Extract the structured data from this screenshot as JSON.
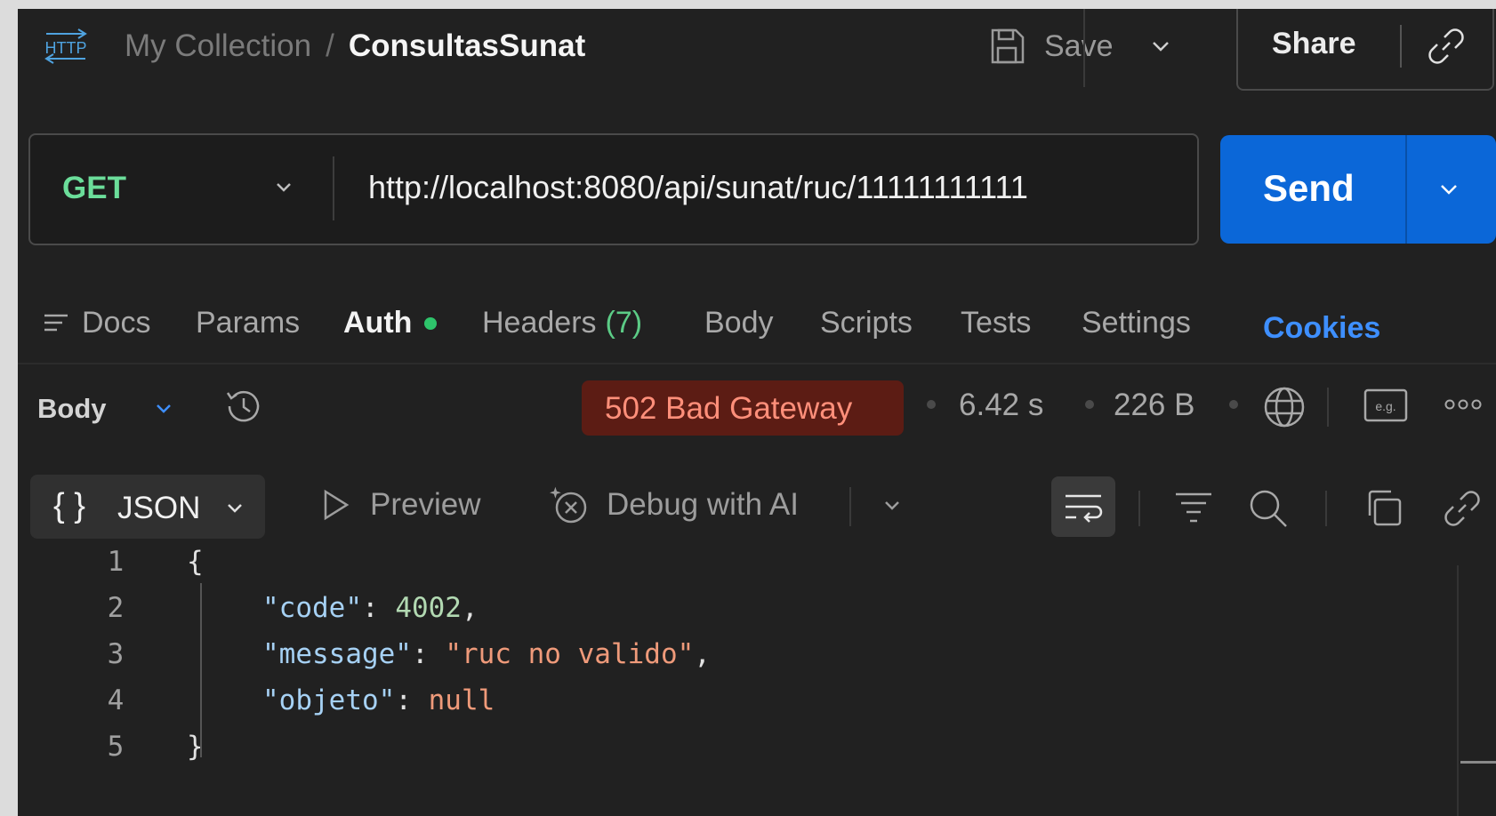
{
  "header": {
    "http_icon_label": "HTTP",
    "breadcrumb_parent": "My Collection",
    "breadcrumb_separator": "/",
    "breadcrumb_current": "ConsultasSunat",
    "save_label": "Save",
    "share_label": "Share"
  },
  "request": {
    "method": "GET",
    "url": "http://localhost:8080/api/sunat/ruc/11111111111",
    "send_label": "Send"
  },
  "request_tabs": {
    "docs": "Docs",
    "params": "Params",
    "auth": "Auth",
    "headers": "Headers",
    "headers_count": "(7)",
    "body": "Body",
    "scripts": "Scripts",
    "tests": "Tests",
    "settings": "Settings",
    "cookies": "Cookies"
  },
  "response": {
    "body_label": "Body",
    "status": "502 Bad Gateway",
    "time": "6.42 s",
    "size": "226 B",
    "eg_label": "e.g."
  },
  "viewer": {
    "format_braces": "{ }",
    "format_label": "JSON",
    "preview_label": "Preview",
    "debug_label": "Debug with AI"
  },
  "code": {
    "line_numbers": [
      "1",
      "2",
      "3",
      "4",
      "5"
    ],
    "open_brace": "{",
    "close_brace": "}",
    "code_key": "\"code\"",
    "code_value": "4002",
    "message_key": "\"message\"",
    "message_value": "\"ruc no valido\"",
    "objeto_key": "\"objeto\"",
    "objeto_value": "null",
    "colon": ": ",
    "comma": ","
  },
  "colors": {
    "accent_blue": "#0b67d8",
    "method_green": "#6bdd9a",
    "status_error_bg": "#5c1c14",
    "status_error_text": "#ff8f7a",
    "cookies_link": "#3e8fff"
  }
}
